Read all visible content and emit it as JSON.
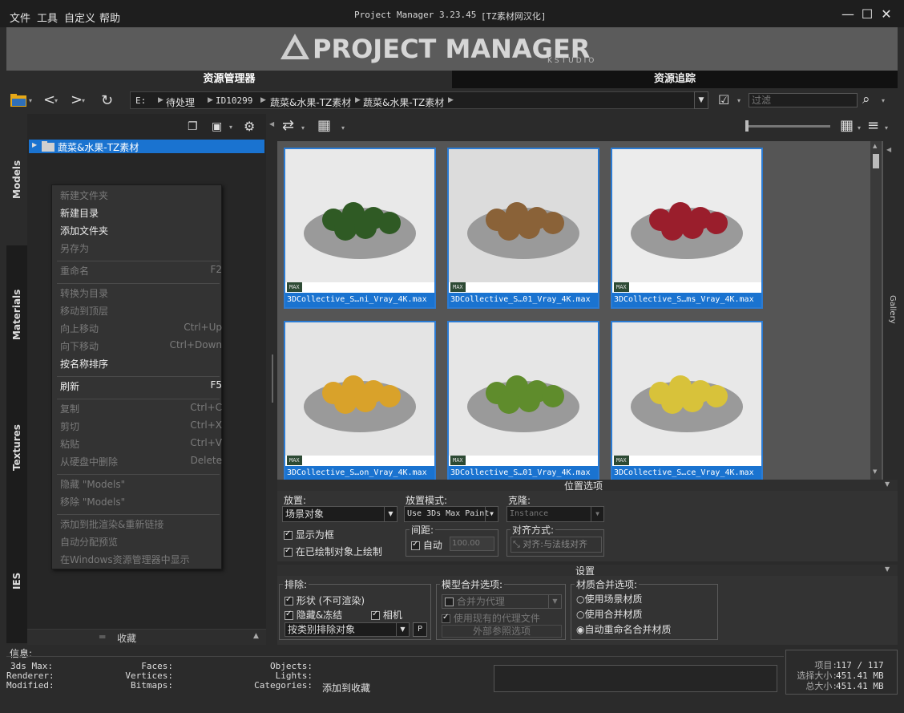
{
  "menu": [
    "文件",
    "工具",
    "自定义",
    "帮助"
  ],
  "window": {
    "title": "Project Manager 3.23.45",
    "subtitle": "[TZ素材网汉化]"
  },
  "logo": {
    "main": "PROJECT MANAGER",
    "sub": "KSTUDIO"
  },
  "tabs": {
    "left": "资源管理器",
    "right": "资源追踪"
  },
  "breadcrumb": [
    "E:",
    "待处理",
    "ID10299",
    "蔬菜&水果-TZ素材",
    "蔬菜&水果-TZ素材"
  ],
  "filter": {
    "placeholder": "过滤"
  },
  "sidetabs": [
    "Models",
    "Materials",
    "Textures",
    "IES"
  ],
  "tree": {
    "node": "蔬菜&水果-TZ素材"
  },
  "context_menu": [
    {
      "label": "新建文件夹",
      "enabled": false
    },
    {
      "label": "新建目录",
      "enabled": true
    },
    {
      "label": "添加文件夹",
      "enabled": true
    },
    {
      "label": "另存为",
      "enabled": false
    },
    {
      "sep": true
    },
    {
      "label": "重命名",
      "shortcut": "F2",
      "enabled": false
    },
    {
      "sep": true
    },
    {
      "label": "转换为目录",
      "enabled": false
    },
    {
      "label": "移动到顶层",
      "enabled": false
    },
    {
      "label": "向上移动",
      "shortcut": "Ctrl+Up",
      "enabled": false
    },
    {
      "label": "向下移动",
      "shortcut": "Ctrl+Down",
      "enabled": false
    },
    {
      "label": "按名称排序",
      "enabled": true
    },
    {
      "sep": true
    },
    {
      "label": "刷新",
      "shortcut": "F5",
      "enabled": true
    },
    {
      "sep": true
    },
    {
      "label": "复制",
      "shortcut": "Ctrl+C",
      "enabled": false
    },
    {
      "label": "剪切",
      "shortcut": "Ctrl+X",
      "enabled": false
    },
    {
      "label": "粘贴",
      "shortcut": "Ctrl+V",
      "enabled": false
    },
    {
      "label": "从硬盘中删除",
      "shortcut": "Delete",
      "enabled": false
    },
    {
      "sep": true
    },
    {
      "label": "隐藏 \"Models\"",
      "enabled": false
    },
    {
      "label": "移除 \"Models\"",
      "enabled": false
    },
    {
      "sep": true
    },
    {
      "label": "添加到批渲染&重新链接",
      "enabled": false
    },
    {
      "label": "自动分配预览",
      "enabled": false
    },
    {
      "label": "在Windows资源管理器中显示",
      "enabled": false
    }
  ],
  "favorites": "收藏",
  "assets": [
    {
      "name": "3DCollective_S…ni_Vray_4K.max",
      "badge": "MAX",
      "bg": "#e9e9e9",
      "fruit": "#2f5a24"
    },
    {
      "name": "3DCollective_S…01_Vray_4K.max",
      "badge": "MAX",
      "bg": "#dcdcdc",
      "fruit": "#8a6238"
    },
    {
      "name": "3DCollective_S…ms_Vray_4K.max",
      "badge": "MAX",
      "bg": "#ececec",
      "fruit": "#9a1e2c"
    },
    {
      "name": "3DCollective_S…on_Vray_4K.max",
      "badge": "MAX",
      "bg": "#e4e4e4",
      "fruit": "#d9a22a"
    },
    {
      "name": "3DCollective_S…01_Vray_4K.max",
      "badge": "MAX",
      "bg": "#e6e6e6",
      "fruit": "#5f8c2c"
    },
    {
      "name": "3DCollective_S…ce_Vray_4K.max",
      "badge": "MAX",
      "bg": "#e8e8e8",
      "fruit": "#d8c23a"
    }
  ],
  "gallery_label": "Gallery",
  "placement": {
    "title": "位置选项",
    "place_label": "放置:",
    "place_value": "场景对象",
    "mode_label": "放置模式:",
    "mode_value": "Use 3Ds Max Paint",
    "clone_label": "克隆:",
    "clone_value": "Instance",
    "show_frame": "显示为框",
    "draw_on": "在已绘制对象上绘制",
    "spacing_label": "间距:",
    "auto": "自动",
    "spacing_value": "100.00",
    "align_label": "对齐方式:",
    "align_value": "对齐:与法线对齐"
  },
  "settings": {
    "title": "设置",
    "exclude_label": "排除:",
    "shape": "形状 (不可渲染)",
    "hidden": "隐藏&冻结",
    "camera": "相机",
    "exclude_by": "按类别排除对象",
    "p": "P",
    "merge_label": "模型合并选项:",
    "merge_proxy": "合并为代理",
    "use_proxy": "使用现有的代理文件",
    "xref": "外部参照选项",
    "mat_label": "材质合并选项:",
    "mat_scene": "使用场景材质",
    "mat_merge": "使用合并材质",
    "mat_auto": "自动重命名合并材质"
  },
  "info": {
    "title": "信息:",
    "k1": [
      "3ds Max:",
      "Renderer:",
      "Modified:"
    ],
    "k2": [
      "Faces:",
      "Vertices:",
      "Bitmaps:"
    ],
    "k3": [
      "Objects:",
      "Lights:",
      "Categories:"
    ],
    "add_fav": "添加到收藏",
    "stats_labels": [
      "项目:",
      "选择大小:",
      "总大小:"
    ],
    "stats_values": [
      "117 / 117",
      "451.41 MB",
      "451.41 MB"
    ]
  }
}
